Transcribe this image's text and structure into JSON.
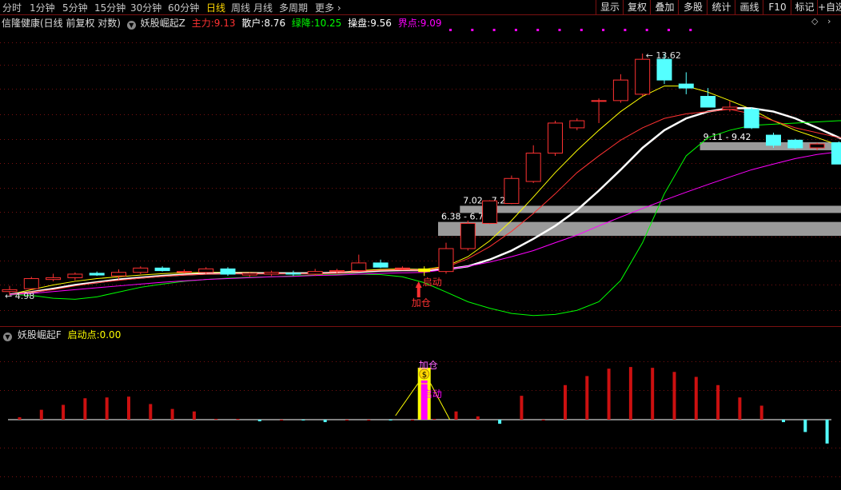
{
  "period_tabs": [
    "分时",
    "1分钟",
    "5分钟",
    "15分钟",
    "30分钟",
    "60分钟",
    "日线",
    "周线",
    "月线",
    "多周期",
    "更多"
  ],
  "active_period": "日线",
  "toolbar_buttons": [
    "显示",
    "复权",
    "叠加",
    "多股",
    "统计",
    "画线",
    "F10",
    "标记",
    "+自选"
  ],
  "main_header": {
    "stock": "信隆健康(日线 前复权 对数)",
    "indicator": "妖股崛起Z",
    "zhuli_label": "主力:",
    "zhuli_value": "9.13",
    "sanhu_label": "散户:",
    "sanhu_value": "8.76",
    "lvjiang_label": "绿降:",
    "lvjiang_value": "10.25",
    "caopan_label": "操盘:",
    "caopan_value": "9.56",
    "jiedian_label": "界点:",
    "jiedian_value": "9.09"
  },
  "sub_header": {
    "indicator": "妖股崛起F",
    "qidong_label": "启动点:",
    "qidong_value": "0.00"
  },
  "annotations": {
    "high": "13.62",
    "low": "4.98",
    "zone1": "9.11 - 9.42",
    "zone2": "7.02 - 7.23",
    "zone3": "6.38 - 6.76",
    "start_label": "启动",
    "add_label": "加仓",
    "dollar": "$"
  },
  "colors": {
    "up": "#ff3232",
    "down": "#54ffff",
    "start": "#ffff00",
    "zhuli": "#ffff00",
    "sanhu": "#ffffff",
    "lvjiang": "#00ff00",
    "caopan": "#ff3232",
    "jiedian": "#ff00ff",
    "border": "#7a1010"
  },
  "chart_data": {
    "type": "candlestick",
    "scale": "log",
    "price_range": [
      4.5,
      15.0
    ],
    "candles": [
      {
        "o": 5.06,
        "h": 5.18,
        "l": 4.98,
        "c": 5.1
      },
      {
        "o": 5.12,
        "h": 5.38,
        "l": 5.1,
        "c": 5.34
      },
      {
        "o": 5.32,
        "h": 5.45,
        "l": 5.28,
        "c": 5.36
      },
      {
        "o": 5.36,
        "h": 5.48,
        "l": 5.3,
        "c": 5.44
      },
      {
        "o": 5.46,
        "h": 5.5,
        "l": 5.4,
        "c": 5.42
      },
      {
        "o": 5.4,
        "h": 5.55,
        "l": 5.32,
        "c": 5.48
      },
      {
        "o": 5.48,
        "h": 5.62,
        "l": 5.44,
        "c": 5.58
      },
      {
        "o": 5.58,
        "h": 5.62,
        "l": 5.5,
        "c": 5.52
      },
      {
        "o": 5.5,
        "h": 5.55,
        "l": 5.45,
        "c": 5.5
      },
      {
        "o": 5.48,
        "h": 5.6,
        "l": 5.45,
        "c": 5.56
      },
      {
        "o": 5.56,
        "h": 5.6,
        "l": 5.4,
        "c": 5.44
      },
      {
        "o": 5.42,
        "h": 5.48,
        "l": 5.38,
        "c": 5.46
      },
      {
        "o": 5.44,
        "h": 5.52,
        "l": 5.4,
        "c": 5.48
      },
      {
        "o": 5.46,
        "h": 5.52,
        "l": 5.4,
        "c": 5.44
      },
      {
        "o": 5.44,
        "h": 5.56,
        "l": 5.4,
        "c": 5.5
      },
      {
        "o": 5.5,
        "h": 5.56,
        "l": 5.46,
        "c": 5.52
      },
      {
        "o": 5.52,
        "h": 5.9,
        "l": 5.5,
        "c": 5.7
      },
      {
        "o": 5.7,
        "h": 5.78,
        "l": 5.58,
        "c": 5.6
      },
      {
        "o": 5.58,
        "h": 5.62,
        "l": 5.54,
        "c": 5.58
      },
      {
        "o": 5.56,
        "h": 5.62,
        "l": 5.4,
        "c": 5.5
      },
      {
        "o": 5.5,
        "h": 6.2,
        "l": 5.45,
        "c": 6.05
      },
      {
        "o": 6.05,
        "h": 6.8,
        "l": 6.0,
        "c": 6.72
      },
      {
        "o": 6.72,
        "h": 7.4,
        "l": 6.7,
        "c": 7.38
      },
      {
        "o": 7.3,
        "h": 8.2,
        "l": 7.28,
        "c": 8.1
      },
      {
        "o": 8.0,
        "h": 9.3,
        "l": 7.95,
        "c": 9.0
      },
      {
        "o": 9.0,
        "h": 10.3,
        "l": 8.9,
        "c": 10.2
      },
      {
        "o": 10.0,
        "h": 10.4,
        "l": 9.9,
        "c": 10.3
      },
      {
        "o": 11.2,
        "h": 11.3,
        "l": 10.2,
        "c": 11.2
      },
      {
        "o": 11.2,
        "h": 12.5,
        "l": 11.1,
        "c": 12.2
      },
      {
        "o": 11.5,
        "h": 13.62,
        "l": 11.4,
        "c": 13.3
      },
      {
        "o": 13.3,
        "h": 13.62,
        "l": 12.0,
        "c": 12.2
      },
      {
        "o": 12.0,
        "h": 12.6,
        "l": 11.5,
        "c": 11.8
      },
      {
        "o": 11.4,
        "h": 11.8,
        "l": 11.0,
        "c": 10.9
      },
      {
        "o": 10.8,
        "h": 11.2,
        "l": 10.7,
        "c": 10.9
      },
      {
        "o": 10.8,
        "h": 10.9,
        "l": 9.95,
        "c": 10.0
      },
      {
        "o": 9.7,
        "h": 9.8,
        "l": 9.2,
        "c": 9.3
      },
      {
        "o": 9.5,
        "h": 9.55,
        "l": 9.15,
        "c": 9.2
      },
      {
        "o": 9.2,
        "h": 9.4,
        "l": 9.1,
        "c": 9.35
      },
      {
        "o": 9.4,
        "h": 9.45,
        "l": 8.6,
        "c": 8.6
      },
      {
        "o": 8.7,
        "h": 8.8,
        "l": 8.5,
        "c": 8.7
      }
    ],
    "start_index": 19,
    "lines": [
      {
        "name": "主力",
        "color": "#ffff00",
        "values": [
          5.0,
          5.1,
          5.2,
          5.28,
          5.34,
          5.38,
          5.42,
          5.45,
          5.47,
          5.48,
          5.48,
          5.48,
          5.47,
          5.47,
          5.47,
          5.48,
          5.52,
          5.55,
          5.56,
          5.55,
          5.62,
          5.85,
          6.25,
          6.8,
          7.5,
          8.3,
          9.1,
          9.9,
          10.7,
          11.4,
          11.9,
          11.9,
          11.6,
          11.2,
          10.8,
          10.3,
          9.9,
          9.6,
          9.3,
          9.13
        ]
      },
      {
        "name": "散户",
        "color": "#ffffff",
        "values": [
          5.0,
          5.05,
          5.12,
          5.2,
          5.26,
          5.32,
          5.36,
          5.4,
          5.43,
          5.45,
          5.46,
          5.46,
          5.46,
          5.46,
          5.46,
          5.47,
          5.49,
          5.52,
          5.53,
          5.53,
          5.55,
          5.62,
          5.78,
          6.0,
          6.3,
          6.65,
          7.1,
          7.7,
          8.4,
          9.2,
          9.9,
          10.4,
          10.7,
          10.85,
          10.85,
          10.7,
          10.4,
          10.0,
          9.6,
          9.3
        ]
      },
      {
        "name": "绿降",
        "color": "#00ff00",
        "values": [
          5.0,
          4.98,
          4.92,
          4.9,
          4.95,
          5.05,
          5.15,
          5.22,
          5.28,
          5.32,
          5.35,
          5.37,
          5.38,
          5.4,
          5.42,
          5.43,
          5.44,
          5.43,
          5.38,
          5.25,
          5.05,
          4.85,
          4.72,
          4.62,
          4.58,
          4.6,
          4.68,
          4.85,
          5.3,
          6.2,
          7.6,
          8.9,
          9.6,
          9.9,
          10.1,
          10.15,
          10.2,
          10.25,
          10.3,
          10.3
        ]
      },
      {
        "name": "操盘",
        "color": "#ff3232",
        "values": [
          5.0,
          5.05,
          5.1,
          5.18,
          5.25,
          5.3,
          5.35,
          5.39,
          5.42,
          5.44,
          5.45,
          5.45,
          5.45,
          5.45,
          5.45,
          5.46,
          5.5,
          5.53,
          5.54,
          5.53,
          5.6,
          5.8,
          6.1,
          6.5,
          7.0,
          7.6,
          8.3,
          8.9,
          9.5,
          10.0,
          10.4,
          10.6,
          10.7,
          10.8,
          10.6,
          10.3,
          10.0,
          9.8,
          9.6,
          9.56
        ]
      },
      {
        "name": "界点",
        "color": "#ff00ff",
        "values": [
          5.0,
          5.02,
          5.06,
          5.1,
          5.14,
          5.18,
          5.22,
          5.26,
          5.29,
          5.32,
          5.34,
          5.36,
          5.38,
          5.39,
          5.41,
          5.42,
          5.44,
          5.46,
          5.47,
          5.48,
          5.55,
          5.62,
          5.72,
          5.85,
          6.0,
          6.2,
          6.4,
          6.65,
          6.9,
          7.15,
          7.4,
          7.65,
          7.9,
          8.15,
          8.4,
          8.6,
          8.8,
          8.95,
          9.05,
          9.09
        ]
      }
    ],
    "zones": [
      {
        "label": "9.11 - 9.42",
        "from_index": 32
      },
      {
        "label": "7.02 - 7.23",
        "from_index": 21
      },
      {
        "label": "6.38 - 6.76",
        "from_index": 20
      }
    ],
    "sub_values": [
      0.3,
      1.2,
      1.8,
      2.6,
      2.7,
      2.8,
      1.9,
      1.3,
      1.0,
      0.1,
      0.1,
      -0.2,
      0.0,
      -0.1,
      -0.3,
      0.0,
      0.0,
      -0.1,
      0.0,
      0.1,
      1.0,
      0.4,
      -0.5,
      2.9,
      0.0,
      4.2,
      5.3,
      6.2,
      6.4,
      6.3,
      5.8,
      5.2,
      4.2,
      2.7,
      1.7,
      -0.3,
      -1.5,
      -2.9,
      -4.3,
      -4.8,
      -5.2,
      -5.8,
      -6.3,
      -6.6
    ],
    "sub_range": [
      -6.8,
      6.8
    ]
  }
}
